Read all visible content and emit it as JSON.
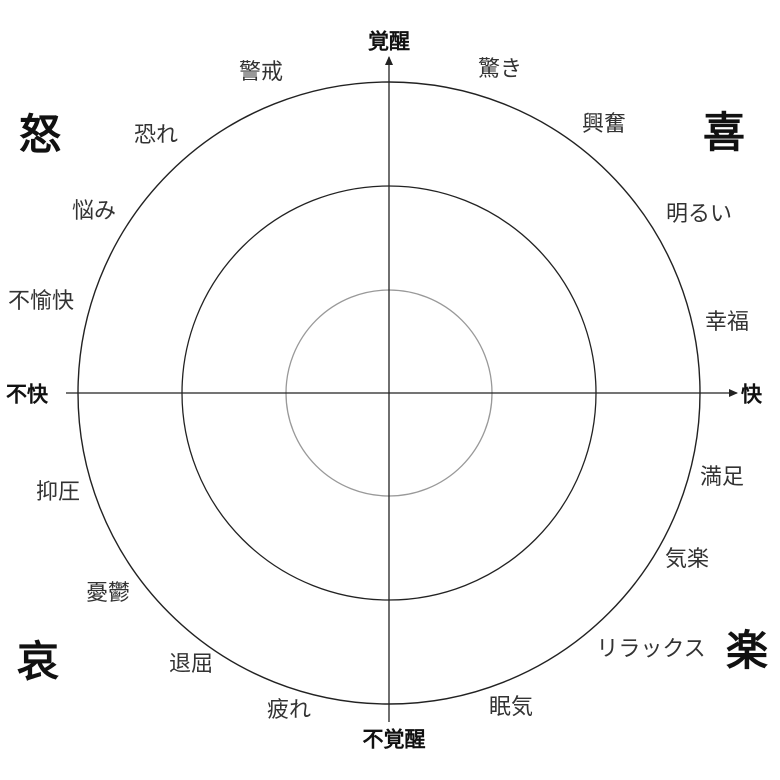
{
  "axes": {
    "top": "覚醒",
    "bottom": "不覚醒",
    "left": "不快",
    "right": "快"
  },
  "quadrants": {
    "top_left": "怒",
    "top_right": "喜",
    "bottom_left": "哀",
    "bottom_right": "楽"
  },
  "emotions": {
    "keikai": "警戒",
    "odoroki": "驚き",
    "osore": "恐れ",
    "kofun": "興奮",
    "nayami": "悩み",
    "akarui": "明るい",
    "fuyukai": "不愉快",
    "kofuku": "幸福",
    "manzoku": "満足",
    "yokuatsu": "抑圧",
    "kiraku": "気楽",
    "yuutsu": "憂鬱",
    "relax": "リラックス",
    "taikutsu": "退屈",
    "tsukare": "疲れ",
    "nemuke": "眠気"
  },
  "colors": {
    "line": "#222222",
    "inner_circle": "#999999"
  }
}
